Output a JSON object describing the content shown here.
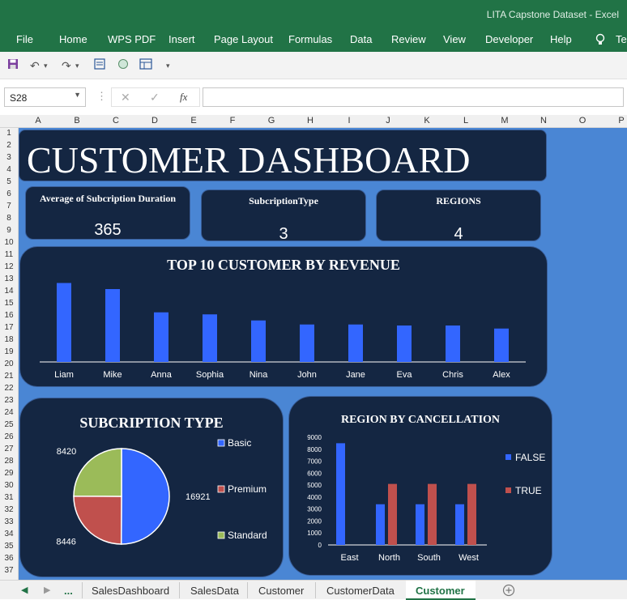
{
  "window": {
    "title": "LITA Capstone Dataset  -  Excel"
  },
  "ribbon": {
    "tabs": [
      "File",
      "Home",
      "WPS PDF",
      "Insert",
      "Page Layout",
      "Formulas",
      "Data",
      "Review",
      "View",
      "Developer",
      "Help"
    ],
    "tell_me": "Tel"
  },
  "formula_bar": {
    "name_box": "S28",
    "fx": "fx",
    "value": ""
  },
  "columns": [
    "A",
    "B",
    "C",
    "D",
    "E",
    "F",
    "G",
    "H",
    "I",
    "J",
    "K",
    "L",
    "M",
    "N",
    "O",
    "P"
  ],
  "rows": [
    "1",
    "2",
    "3",
    "4",
    "5",
    "6",
    "7",
    "8",
    "9",
    "10",
    "11",
    "12",
    "13",
    "14",
    "15",
    "16",
    "17",
    "18",
    "19",
    "20",
    "21",
    "22",
    "23",
    "24",
    "25",
    "26",
    "27",
    "28",
    "29",
    "30",
    "31",
    "32",
    "33",
    "34",
    "35",
    "36",
    "37"
  ],
  "dashboard": {
    "title": "CUSTOMER DASHBOARD",
    "kpis": [
      {
        "label": "Average of Subcription Duration",
        "value": "365"
      },
      {
        "label": "SubcriptionType",
        "value": "3"
      },
      {
        "label": "REGIONS",
        "value": "4"
      }
    ]
  },
  "chart_data": [
    {
      "type": "bar",
      "title": "TOP 10 CUSTOMER BY REVENUE",
      "categories": [
        "Liam",
        "Mike",
        "Anna",
        "Sophia",
        "Nina",
        "John",
        "Jane",
        "Eva",
        "Chris",
        "Alex"
      ],
      "values": [
        78,
        72,
        49,
        47,
        41,
        37,
        37,
        36,
        36,
        33
      ],
      "color": "#3366ff"
    },
    {
      "type": "pie",
      "title": "SUBCRIPTION TYPE",
      "categories": [
        "Basic",
        "Premium",
        "Standard"
      ],
      "values": [
        16921,
        8446,
        8420
      ],
      "colors": [
        "#3366ff",
        "#c0504d",
        "#9bbb59"
      ]
    },
    {
      "type": "bar",
      "title": "REGION BY CANCELLATION",
      "categories": [
        "East",
        "North",
        "South",
        "West"
      ],
      "series": [
        {
          "name": "FALSE",
          "values": [
            8500,
            3400,
            3400,
            3400
          ],
          "color": "#3366ff"
        },
        {
          "name": "TRUE",
          "values": [
            0,
            5100,
            5100,
            5100
          ],
          "color": "#c0504d"
        }
      ],
      "yticks": [
        "0",
        "1000",
        "2000",
        "3000",
        "4000",
        "5000",
        "6000",
        "7000",
        "8000",
        "9000"
      ],
      "ylim": [
        0,
        9000
      ]
    }
  ],
  "sheet_tabs": [
    "...",
    "SalesDashboard",
    "SalesData",
    "Customer",
    "CustomerData",
    "Customer"
  ],
  "active_tab_index": 5
}
